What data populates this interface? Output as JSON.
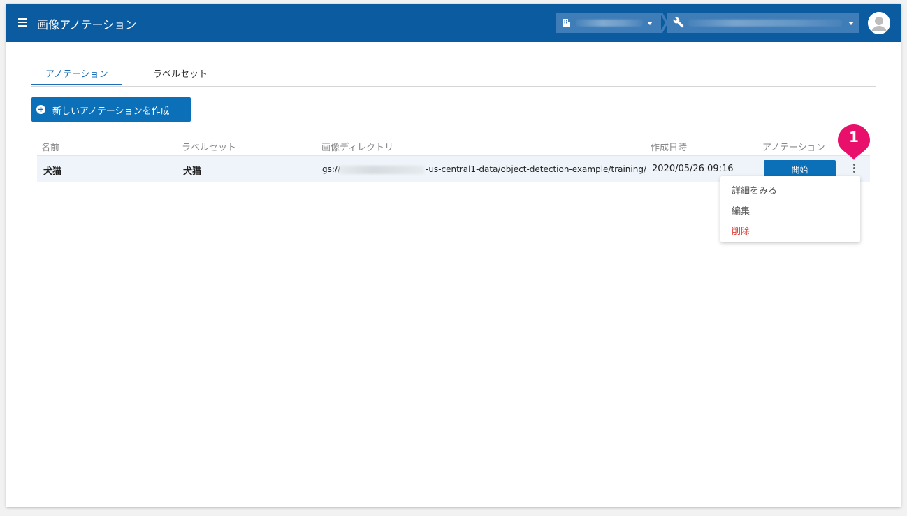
{
  "app": {
    "title": "画像アノテーション"
  },
  "tabs": [
    {
      "label": "アノテーション",
      "active": true
    },
    {
      "label": "ラベルセット",
      "active": false
    }
  ],
  "actions": {
    "create_label": "新しいアノテーションを作成"
  },
  "table": {
    "headers": [
      "名前",
      "ラベルセット",
      "画像ディレクトリ",
      "作成日時",
      "アノテーション"
    ],
    "rows": [
      {
        "name": "犬猫",
        "labelset": "犬猫",
        "dir_prefix": "gs://",
        "dir_suffix": "-us-central1-data/object-detection-example/training/",
        "created": "2020/05/26 09:16",
        "action": "開始"
      }
    ]
  },
  "context_menu": {
    "items": [
      "詳細をみる",
      "編集",
      "削除"
    ]
  },
  "callout": {
    "number": "1"
  },
  "colors": {
    "appbar": "#0b5ba1",
    "primary": "#0b70b8",
    "danger": "#e0403a",
    "callout": "#e8106a"
  },
  "icons": [
    "menu-icon",
    "building-icon",
    "wrench-icon",
    "avatar-icon",
    "plus-circle-icon",
    "more-vert-icon"
  ]
}
